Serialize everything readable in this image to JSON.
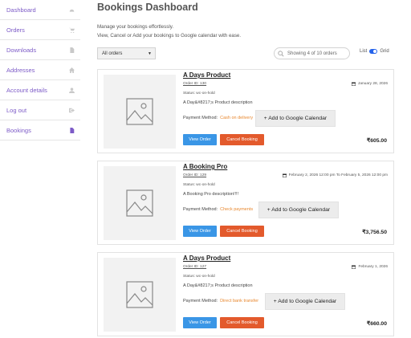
{
  "sidebar": {
    "items": [
      {
        "label": "Dashboard",
        "icon": "gauge-icon"
      },
      {
        "label": "Orders",
        "icon": "cart-icon"
      },
      {
        "label": "Downloads",
        "icon": "file-icon"
      },
      {
        "label": "Addresses",
        "icon": "home-icon"
      },
      {
        "label": "Account details",
        "icon": "user-icon"
      },
      {
        "label": "Log out",
        "icon": "logout-icon"
      },
      {
        "label": "Bookings",
        "icon": "document-icon",
        "active": true
      }
    ]
  },
  "header": {
    "title": "Bookings Dashboard",
    "intro_line1": "Manage your bookings effortlessly.",
    "intro_line2": "View, Cancel or Add your bookings to Google calendar with ease."
  },
  "toolbar": {
    "filter_selected": "All orders",
    "search_placeholder": "Showing 4 of 10 orders",
    "view_list": "List",
    "view_grid": "Grid"
  },
  "bookings": [
    {
      "title": "A Days Product",
      "order_id": "Order ID: 130",
      "date": "January 28, 2026",
      "status": "Status: wc-on-hold",
      "description": "A Day&#8217;s Product description",
      "payment_label": "Payment Method:",
      "payment_method": "Cash on delivery",
      "gcal_label": "+ Add to Google Calendar",
      "view_label": "View Order",
      "cancel_label": "Cancel Booking",
      "price": "₹605.00"
    },
    {
      "title": "A Booking Pro",
      "order_id": "Order ID: 129",
      "date": "February 2, 2026 12:00 pm To February 5, 2026 12:00 pm",
      "status": "Status: wc-on-hold",
      "description": "A Booking Pro description!!!!",
      "payment_label": "Payment Method:",
      "payment_method": "Check payments",
      "gcal_label": "+ Add to Google Calendar",
      "view_label": "View Order",
      "cancel_label": "Cancel Booking",
      "price": "₹3,756.50"
    },
    {
      "title": "A Days Product",
      "order_id": "Order ID: 127",
      "date": "February 1, 2026",
      "status": "Status: wc-on-hold",
      "description": "A Day&#8217;s Product description",
      "payment_label": "Payment Method:",
      "payment_method": "Direct bank transfer",
      "gcal_label": "+ Add to Google Calendar",
      "view_label": "View Order",
      "cancel_label": "Cancel Booking",
      "price": "₹660.00"
    }
  ],
  "colors": {
    "accent": "#7d5bc7",
    "view_button": "#3a96e6",
    "cancel_button": "#e35a2c",
    "payment_text": "#e8872e",
    "toggle": "#2563eb"
  }
}
